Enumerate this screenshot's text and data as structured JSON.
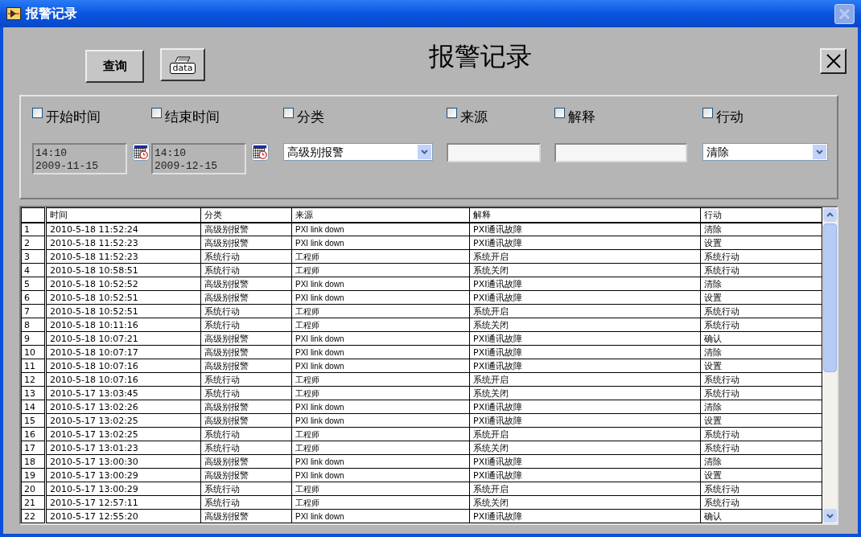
{
  "window": {
    "title": "报警记录",
    "close_disabled": true
  },
  "toolbar": {
    "query_button": "查询",
    "print_button": "data",
    "heading": "报警记录"
  },
  "filters": [
    {
      "kind": "datetime",
      "label": "开始时间",
      "checked": false,
      "time": "14:10",
      "date": "2009-11-15"
    },
    {
      "kind": "datetime",
      "label": "结束时间",
      "checked": false,
      "time": "14:10",
      "date": "2009-12-15"
    },
    {
      "kind": "dropdown",
      "label": "分类",
      "checked": false,
      "value": "高级别报警"
    },
    {
      "kind": "text",
      "label": "来源",
      "checked": false
    },
    {
      "kind": "text",
      "label": "解释",
      "checked": false
    },
    {
      "kind": "dropdown",
      "label": "行动",
      "checked": false,
      "value": "清除"
    }
  ],
  "table": {
    "columns": [
      "时间",
      "分类",
      "来源",
      "解释",
      "行动"
    ],
    "rows": [
      {
        "index": "1",
        "cells": [
          "2010-5-18 11:52:24",
          "高级别报警",
          "PXI link down",
          "PXI通讯故障",
          "清除"
        ]
      },
      {
        "index": "2",
        "cells": [
          "2010-5-18 11:52:23",
          "高级别报警",
          "PXI link down",
          "PXI通讯故障",
          "设置"
        ]
      },
      {
        "index": "3",
        "cells": [
          "2010-5-18 11:52:23",
          "系统行动",
          "工程师",
          "系统开启",
          "系统行动"
        ]
      },
      {
        "index": "4",
        "cells": [
          "2010-5-18 10:58:51",
          "系统行动",
          "工程师",
          "系统关闭",
          "系统行动"
        ]
      },
      {
        "index": "5",
        "cells": [
          "2010-5-18 10:52:52",
          "高级别报警",
          "PXI link down",
          "PXI通讯故障",
          "清除"
        ]
      },
      {
        "index": "6",
        "cells": [
          "2010-5-18 10:52:51",
          "高级别报警",
          "PXI link down",
          "PXI通讯故障",
          "设置"
        ]
      },
      {
        "index": "7",
        "cells": [
          "2010-5-18 10:52:51",
          "系统行动",
          "工程师",
          "系统开启",
          "系统行动"
        ]
      },
      {
        "index": "8",
        "cells": [
          "2010-5-18 10:11:16",
          "系统行动",
          "工程师",
          "系统关闭",
          "系统行动"
        ]
      },
      {
        "index": "9",
        "cells": [
          "2010-5-18 10:07:21",
          "高级别报警",
          "PXI link down",
          "PXI通讯故障",
          "确认"
        ]
      },
      {
        "index": "10",
        "cells": [
          "2010-5-18 10:07:17",
          "高级别报警",
          "PXI link down",
          "PXI通讯故障",
          "清除"
        ]
      },
      {
        "index": "11",
        "cells": [
          "2010-5-18 10:07:16",
          "高级别报警",
          "PXI link down",
          "PXI通讯故障",
          "设置"
        ]
      },
      {
        "index": "12",
        "cells": [
          "2010-5-18 10:07:16",
          "系统行动",
          "工程师",
          "系统开启",
          "系统行动"
        ]
      },
      {
        "index": "13",
        "cells": [
          "2010-5-17 13:03:45",
          "系统行动",
          "工程师",
          "系统关闭",
          "系统行动"
        ]
      },
      {
        "index": "14",
        "cells": [
          "2010-5-17 13:02:26",
          "高级别报警",
          "PXI link down",
          "PXI通讯故障",
          "清除"
        ]
      },
      {
        "index": "15",
        "cells": [
          "2010-5-17 13:02:25",
          "高级别报警",
          "PXI link down",
          "PXI通讯故障",
          "设置"
        ]
      },
      {
        "index": "16",
        "cells": [
          "2010-5-17 13:02:25",
          "系统行动",
          "工程师",
          "系统开启",
          "系统行动"
        ]
      },
      {
        "index": "17",
        "cells": [
          "2010-5-17 13:01:23",
          "系统行动",
          "工程师",
          "系统关闭",
          "系统行动"
        ]
      },
      {
        "index": "18",
        "cells": [
          "2010-5-17 13:00:30",
          "高级别报警",
          "PXI link down",
          "PXI通讯故障",
          "清除"
        ]
      },
      {
        "index": "19",
        "cells": [
          "2010-5-17 13:00:29",
          "高级别报警",
          "PXI link down",
          "PXI通讯故障",
          "设置"
        ]
      },
      {
        "index": "20",
        "cells": [
          "2010-5-17 13:00:29",
          "系统行动",
          "工程师",
          "系统开启",
          "系统行动"
        ]
      },
      {
        "index": "21",
        "cells": [
          "2010-5-17 12:57:11",
          "系统行动",
          "工程师",
          "系统关闭",
          "系统行动"
        ]
      },
      {
        "index": "22",
        "cells": [
          "2010-5-17 12:55:20",
          "高级别报警",
          "PXI link down",
          "PXI通讯故障",
          "确认"
        ]
      }
    ]
  }
}
